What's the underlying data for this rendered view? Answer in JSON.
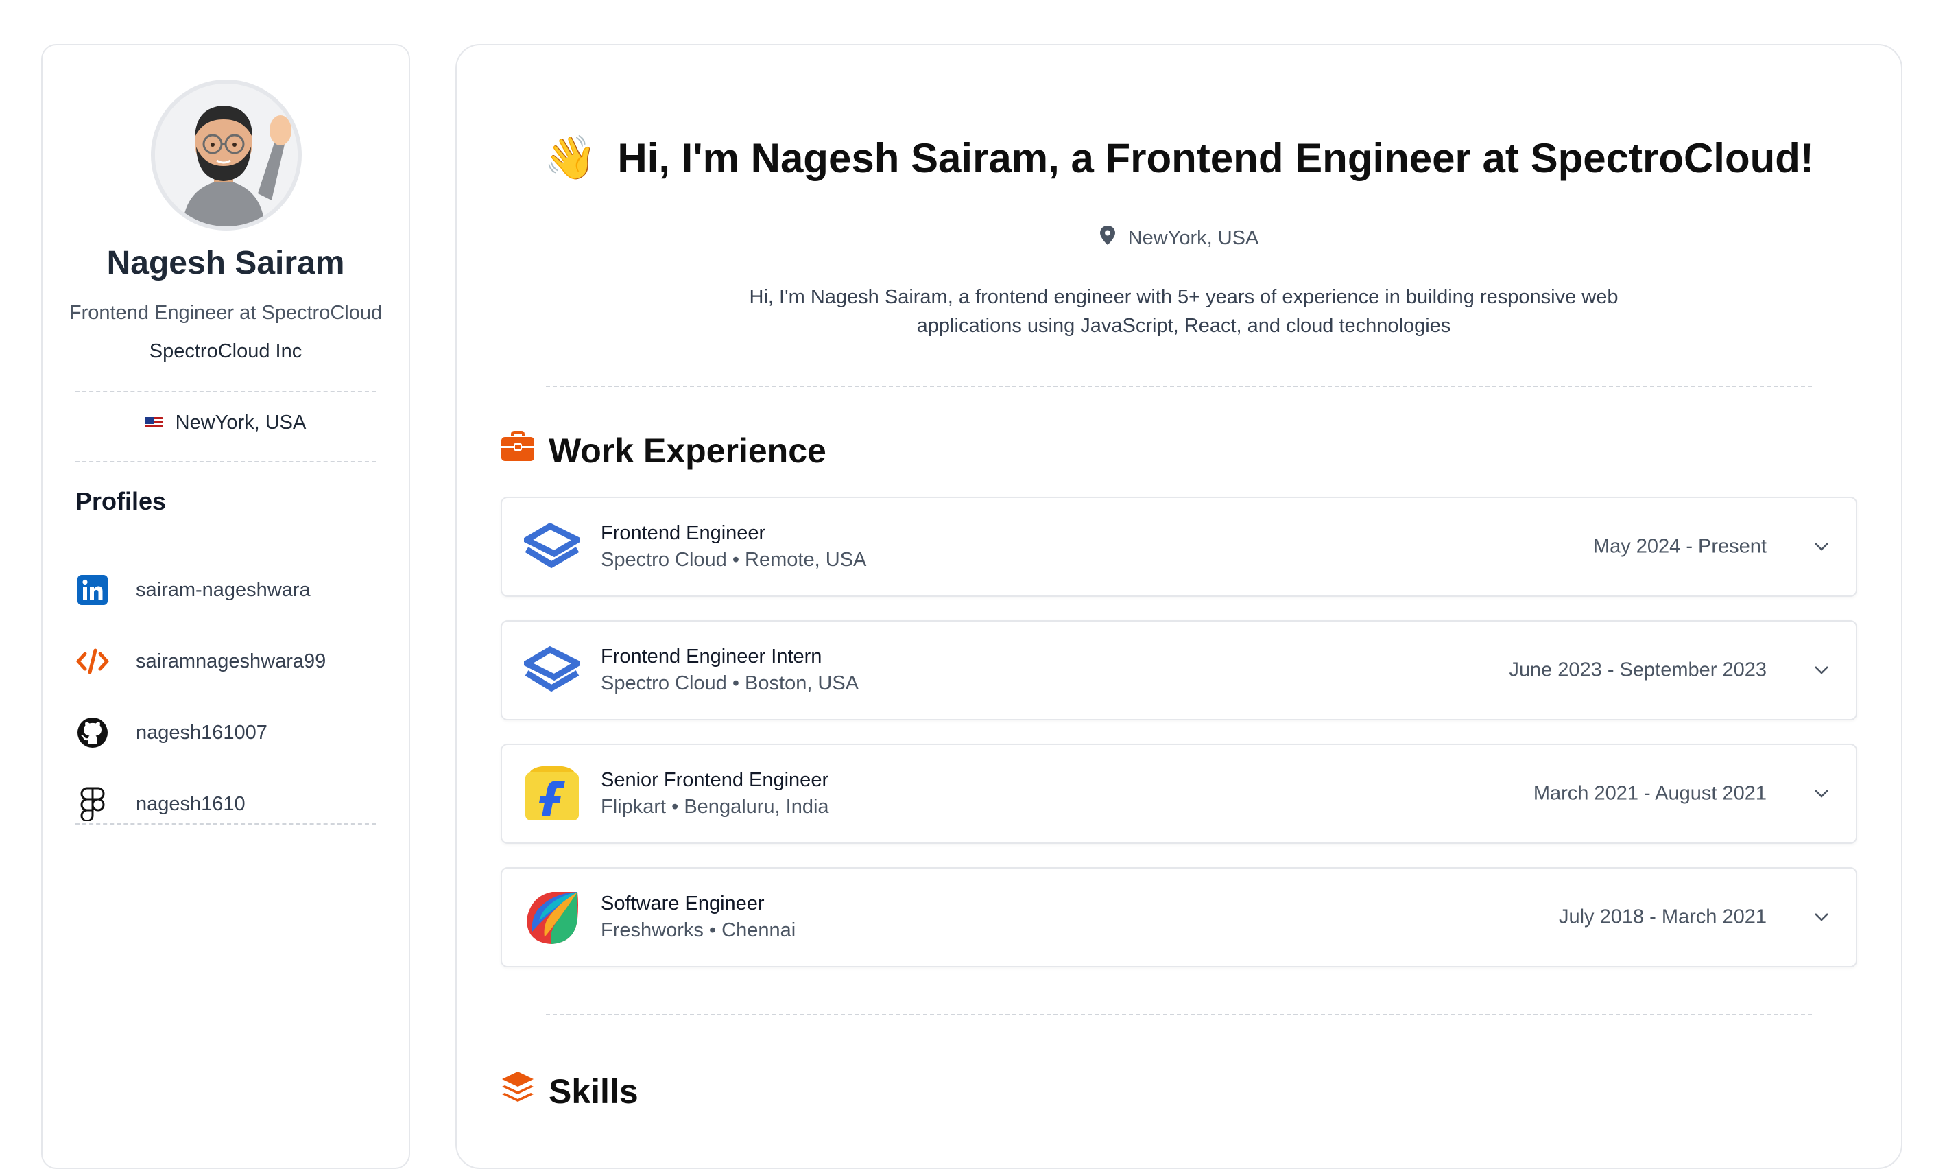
{
  "sidebar": {
    "name": "Nagesh Sairam",
    "role": "Frontend Engineer at SpectroCloud",
    "company": "SpectroCloud Inc",
    "location": "NewYork, USA",
    "profiles_title": "Profiles",
    "profiles": [
      {
        "icon": "linkedin-icon",
        "label": "sairam-nageshwara"
      },
      {
        "icon": "code-icon",
        "label": "sairamnageshwara99"
      },
      {
        "icon": "github-icon",
        "label": "nagesh161007"
      },
      {
        "icon": "figma-icon",
        "label": "nagesh1610"
      }
    ]
  },
  "main": {
    "wave": "👋",
    "headline": "Hi, I'm Nagesh Sairam, a Frontend Engineer at SpectroCloud!",
    "location": "NewYork, USA",
    "bio": "Hi, I'm Nagesh Sairam, a frontend engineer with 5+ years of experience in building responsive web applications using JavaScript, React, and cloud technologies",
    "work_title": "Work Experience",
    "jobs": [
      {
        "title": "Frontend Engineer",
        "subtitle": "Spectro Cloud • Remote, USA",
        "dates": "May 2024 - Present",
        "logo": "spectrocloud-logo"
      },
      {
        "title": "Frontend Engineer Intern",
        "subtitle": "Spectro Cloud • Boston, USA",
        "dates": "June 2023 - September 2023",
        "logo": "spectrocloud-logo"
      },
      {
        "title": "Senior Frontend Engineer",
        "subtitle": "Flipkart • Bengaluru, India",
        "dates": "March 2021 - August 2021",
        "logo": "flipkart-logo"
      },
      {
        "title": "Software Engineer",
        "subtitle": "Freshworks • Chennai",
        "dates": "July 2018 - March 2021",
        "logo": "freshworks-logo"
      }
    ],
    "skills_title": "Skills"
  },
  "colors": {
    "accent": "#ea580c",
    "linkedin": "#0a66c2",
    "spectro": "#3b6fd4"
  }
}
